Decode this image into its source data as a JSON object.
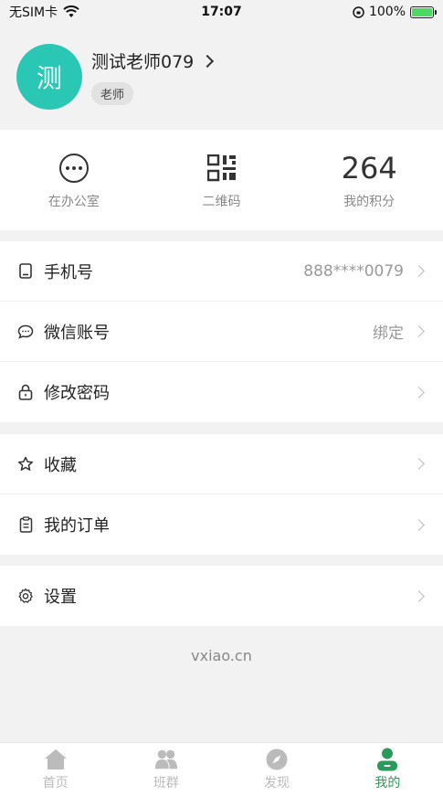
{
  "status_bar": {
    "carrier": "无SIM卡",
    "time": "17:07",
    "battery": "100%"
  },
  "profile": {
    "avatar_char": "测",
    "name": "测试老师079",
    "role": "老师"
  },
  "stats": [
    {
      "label": "在办公室",
      "icon": "more-dots-icon"
    },
    {
      "label": "二维码",
      "icon": "qrcode-icon"
    },
    {
      "label": "我的积分",
      "value": "264"
    }
  ],
  "account": {
    "phone": {
      "label": "手机号",
      "value": "888****0079",
      "icon": "phone-icon"
    },
    "wechat": {
      "label": "微信账号",
      "value": "绑定",
      "icon": "chat-bubble-icon"
    },
    "password": {
      "label": "修改密码",
      "icon": "lock-icon"
    }
  },
  "personal": {
    "favorites": {
      "label": "收藏",
      "icon": "star-icon"
    },
    "orders": {
      "label": "我的订单",
      "icon": "clipboard-icon"
    }
  },
  "settings": {
    "label": "设置",
    "icon": "gear-icon"
  },
  "footer": {
    "text": "vxiao.cn"
  },
  "tabbar": [
    {
      "label": "首页",
      "icon": "home-icon"
    },
    {
      "label": "班群",
      "icon": "group-icon"
    },
    {
      "label": "发现",
      "icon": "compass-icon"
    },
    {
      "label": "我的",
      "icon": "person-icon",
      "active": true
    }
  ],
  "colors": {
    "accent": "#2a9a5a",
    "avatar": "#2bc7b5"
  }
}
